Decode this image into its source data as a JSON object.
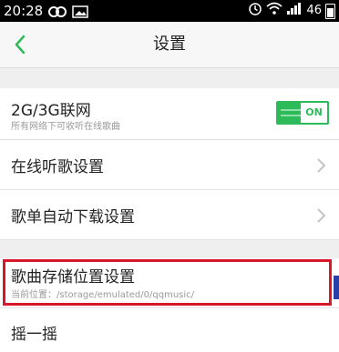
{
  "status_bar": {
    "time": "20:28",
    "battery_level": "46",
    "icons": [
      "loop-icon",
      "image-icon",
      "alarm-icon",
      "wifi-icon",
      "signal-icon",
      "battery-icon"
    ]
  },
  "nav": {
    "title": "设置",
    "back_icon": "chevron-left-icon"
  },
  "settings": {
    "network": {
      "title": "2G/3G联网",
      "subtitle": "所有网络下可收听在线歌曲",
      "toggle_label": "ON",
      "enabled": true
    },
    "online_listening": {
      "title": "在线听歌设置"
    },
    "auto_download": {
      "title": "歌单自动下载设置"
    },
    "storage": {
      "title": "歌曲存储位置设置",
      "subtitle": "当前位置：/storage/emulated/0/qqmusic/"
    },
    "shake": {
      "title": "摇一摇"
    }
  },
  "colors": {
    "accent_green": "#2dbb5a",
    "highlight_red": "#d7182a"
  }
}
